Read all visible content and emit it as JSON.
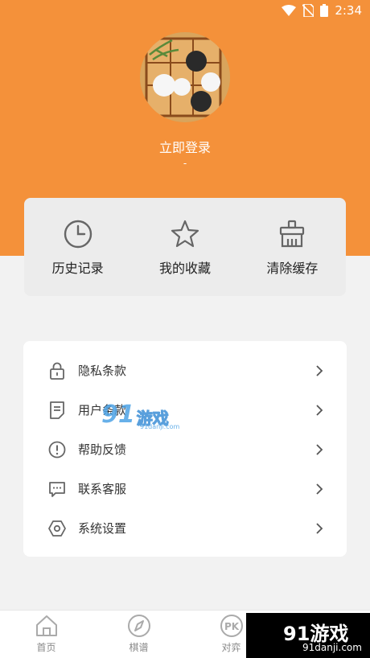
{
  "status_bar": {
    "time": "2:34"
  },
  "profile": {
    "login_label": "立即登录",
    "subtitle": "-"
  },
  "quick_actions": [
    {
      "label": "历史记录",
      "icon": "clock-icon"
    },
    {
      "label": "我的收藏",
      "icon": "star-icon"
    },
    {
      "label": "清除缓存",
      "icon": "broom-icon"
    }
  ],
  "menu": [
    {
      "label": "隐私条款",
      "icon": "lock-icon"
    },
    {
      "label": "用户条款",
      "icon": "document-icon"
    },
    {
      "label": "帮助反馈",
      "icon": "exclamation-circle-icon"
    },
    {
      "label": "联系客服",
      "icon": "chat-bubble-icon"
    },
    {
      "label": "系统设置",
      "icon": "hexagon-settings-icon"
    }
  ],
  "tabbar": [
    {
      "label": "首页",
      "icon": "home-icon"
    },
    {
      "label": "棋谱",
      "icon": "compass-icon"
    },
    {
      "label": "对弈",
      "icon": "pk-icon",
      "icon_text": "PK"
    }
  ],
  "watermark": {
    "brand_num": "91",
    "brand_text": "游戏",
    "url": "91danji.com"
  },
  "colors": {
    "accent": "#f4913a",
    "card_bg": "#ececec",
    "icon_gray": "#666666"
  }
}
